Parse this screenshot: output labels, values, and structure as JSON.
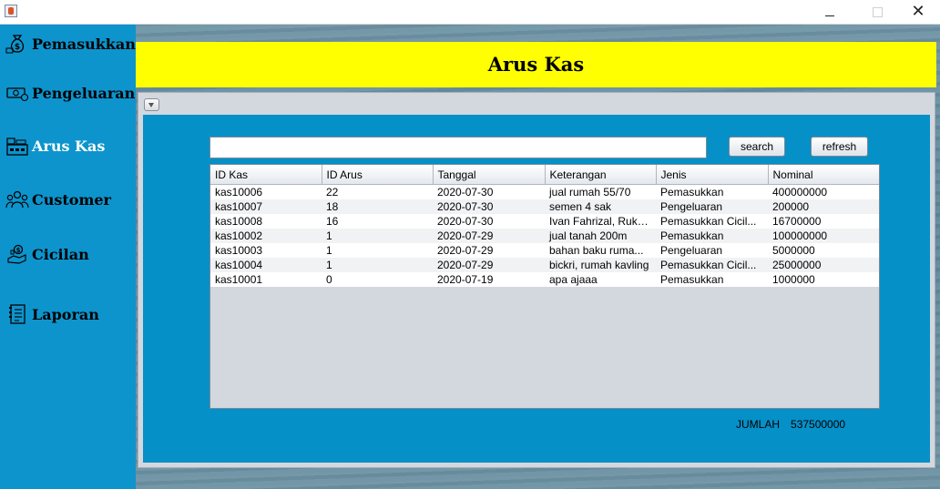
{
  "window": {
    "close_glyph": "✕",
    "app_icon": "java-cup-icon"
  },
  "sidebar": {
    "bg_color": "#0d94cd",
    "items": [
      {
        "label": "Pemasukkan",
        "icon": "money-bag-icon",
        "active": false
      },
      {
        "label": "Pengeluaran",
        "icon": "cash-bill-icon",
        "active": false
      },
      {
        "label": "Arus Kas",
        "icon": "cash-register-icon",
        "active": true
      },
      {
        "label": "Customer",
        "icon": "users-icon",
        "active": false
      },
      {
        "label": "Cicilan",
        "icon": "installment-icon",
        "active": false
      },
      {
        "label": "Laporan",
        "icon": "report-icon",
        "active": false
      }
    ]
  },
  "header": {
    "title": "Arus Kas",
    "bg_color": "#ffff00"
  },
  "search": {
    "value": "",
    "button_label": "search"
  },
  "refresh": {
    "button_label": "refresh"
  },
  "table": {
    "columns": [
      "ID Kas",
      "ID Arus",
      "Tanggal",
      "Keterangan",
      "Jenis",
      "Nominal"
    ],
    "rows": [
      [
        "kas10006",
        "22",
        "2020-07-30",
        "jual rumah 55/70",
        "Pemasukkan",
        "400000000"
      ],
      [
        "kas10007",
        "18",
        "2020-07-30",
        "semen 4 sak",
        "Pengeluaran",
        "200000"
      ],
      [
        "kas10008",
        "16",
        "2020-07-30",
        "Ivan Fahrizal, Ruko...",
        "Pemasukkan Cicil...",
        "16700000"
      ],
      [
        "kas10002",
        "1",
        "2020-07-29",
        "jual tanah 200m",
        "Pemasukkan",
        "100000000"
      ],
      [
        "kas10003",
        "1",
        "2020-07-29",
        "bahan baku ruma...",
        "Pengeluaran",
        "5000000"
      ],
      [
        "kas10004",
        "1",
        "2020-07-29",
        "bickri, rumah kavling",
        "Pemasukkan Cicil...",
        "25000000"
      ],
      [
        "kas10001",
        "0",
        "2020-07-19",
        "apa ajaaa",
        "Pemasukkan",
        "1000000"
      ]
    ]
  },
  "total": {
    "label": "JUMLAH",
    "value": "537500000"
  },
  "content_bg": "#0590c8"
}
